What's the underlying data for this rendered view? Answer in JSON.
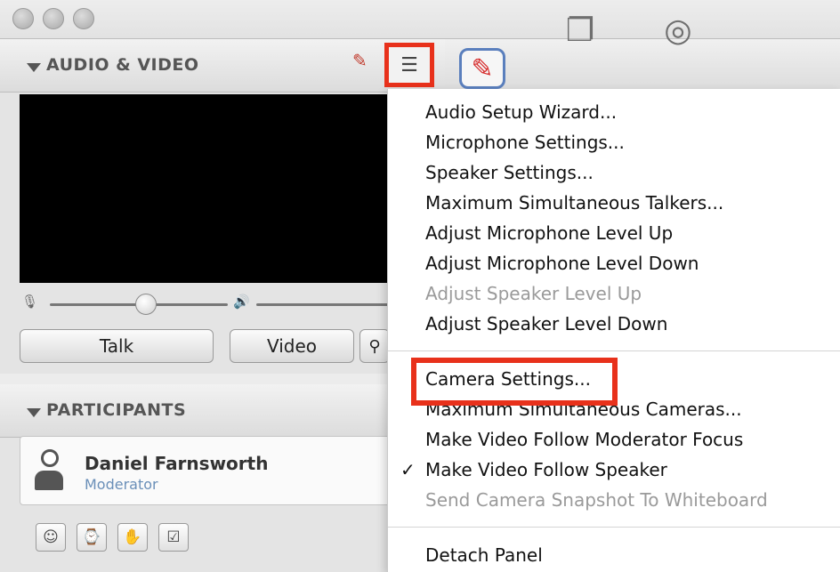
{
  "window": {
    "traffic_lights": [
      "close",
      "minimize",
      "zoom"
    ]
  },
  "audio_video_panel": {
    "title": "AUDIO & VIDEO",
    "mic_level": 0.55,
    "talk_button": "Talk",
    "video_button": "Video"
  },
  "participants_panel": {
    "title": "PARTICIPANTS",
    "participant": {
      "name": "Daniel Farnsworth",
      "role": "Moderator"
    },
    "status_buttons": [
      "status-emoticon-icon",
      "away-icon",
      "raise-hand-icon",
      "checkbox-icon"
    ]
  },
  "toolbar_icons": [
    "whiteboard-icon",
    "app-share-icon",
    "web-tour-icon"
  ],
  "menu": {
    "items": [
      {
        "label": "Audio Setup Wizard...",
        "enabled": true
      },
      {
        "label": "Microphone Settings...",
        "enabled": true
      },
      {
        "label": "Speaker Settings...",
        "enabled": true
      },
      {
        "label": "Maximum Simultaneous Talkers...",
        "enabled": true
      },
      {
        "label": "Adjust Microphone Level Up",
        "enabled": true
      },
      {
        "label": "Adjust Microphone Level Down",
        "enabled": true
      },
      {
        "label": "Adjust Speaker Level Up",
        "enabled": false
      },
      {
        "label": "Adjust Speaker Level Down",
        "enabled": true
      },
      {
        "label": "Camera Settings...",
        "enabled": true
      },
      {
        "label": "Maximum Simultaneous Cameras...",
        "enabled": true
      },
      {
        "label": "Make Video Follow Moderator Focus",
        "enabled": true
      },
      {
        "label": "Make Video Follow Speaker",
        "enabled": true,
        "checked": true
      },
      {
        "label": "Send Camera Snapshot To Whiteboard",
        "enabled": false
      },
      {
        "label": "Detach Panel",
        "enabled": true
      }
    ]
  },
  "colors": {
    "highlight": "#e8311b",
    "role_text": "#6a8fb8",
    "disabled_text": "#9a9a9a"
  }
}
